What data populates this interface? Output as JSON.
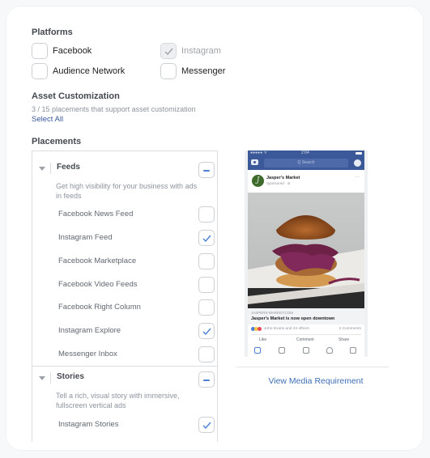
{
  "platforms": {
    "title": "Platforms",
    "items": [
      {
        "label": "Facebook",
        "checked": false,
        "disabled": false
      },
      {
        "label": "Instagram",
        "checked": true,
        "disabled": true
      },
      {
        "label": "Audience Network",
        "checked": false,
        "disabled": false
      },
      {
        "label": "Messenger",
        "checked": false,
        "disabled": false
      }
    ]
  },
  "asset_customization": {
    "title": "Asset Customization",
    "summary": "3 / 15 placements that support asset customization",
    "select_all": "Select All"
  },
  "placements": {
    "title": "Placements",
    "groups": [
      {
        "title": "Feeds",
        "description": "Get high visibility for your business with ads in feeds",
        "items": [
          {
            "label": "Facebook News Feed",
            "checked": false
          },
          {
            "label": "Instagram Feed",
            "checked": true
          },
          {
            "label": "Facebook Marketplace",
            "checked": false
          },
          {
            "label": "Facebook Video Feeds",
            "checked": false
          },
          {
            "label": "Facebook Right Column",
            "checked": false
          },
          {
            "label": "Instagram Explore",
            "checked": true
          },
          {
            "label": "Messenger Inbox",
            "checked": false
          }
        ]
      },
      {
        "title": "Stories",
        "description": "Tell a rich, visual story with immersive, fullscreen vertical ads",
        "items": [
          {
            "label": "Instagram Stories",
            "checked": true
          }
        ]
      }
    ]
  },
  "preview": {
    "status_time": "2:04",
    "search_placeholder": "Q Search",
    "page_name": "Jasper's Market",
    "page_initial": "J",
    "sponsored": "Sponsored · ⊘",
    "more": "···",
    "domain": "JASPERS-MARKET.COM",
    "headline": "Jasper's Market is now open downtown",
    "reactions_text": "John Evans and 23 others",
    "comments_count": "2 Comments",
    "actions": [
      "Like",
      "Comment",
      "Share"
    ],
    "view_media_link": "View Media Requirement"
  },
  "colors": {
    "accent": "#4a7fd4",
    "link": "#385898",
    "facebook_blue": "#3b5998"
  }
}
